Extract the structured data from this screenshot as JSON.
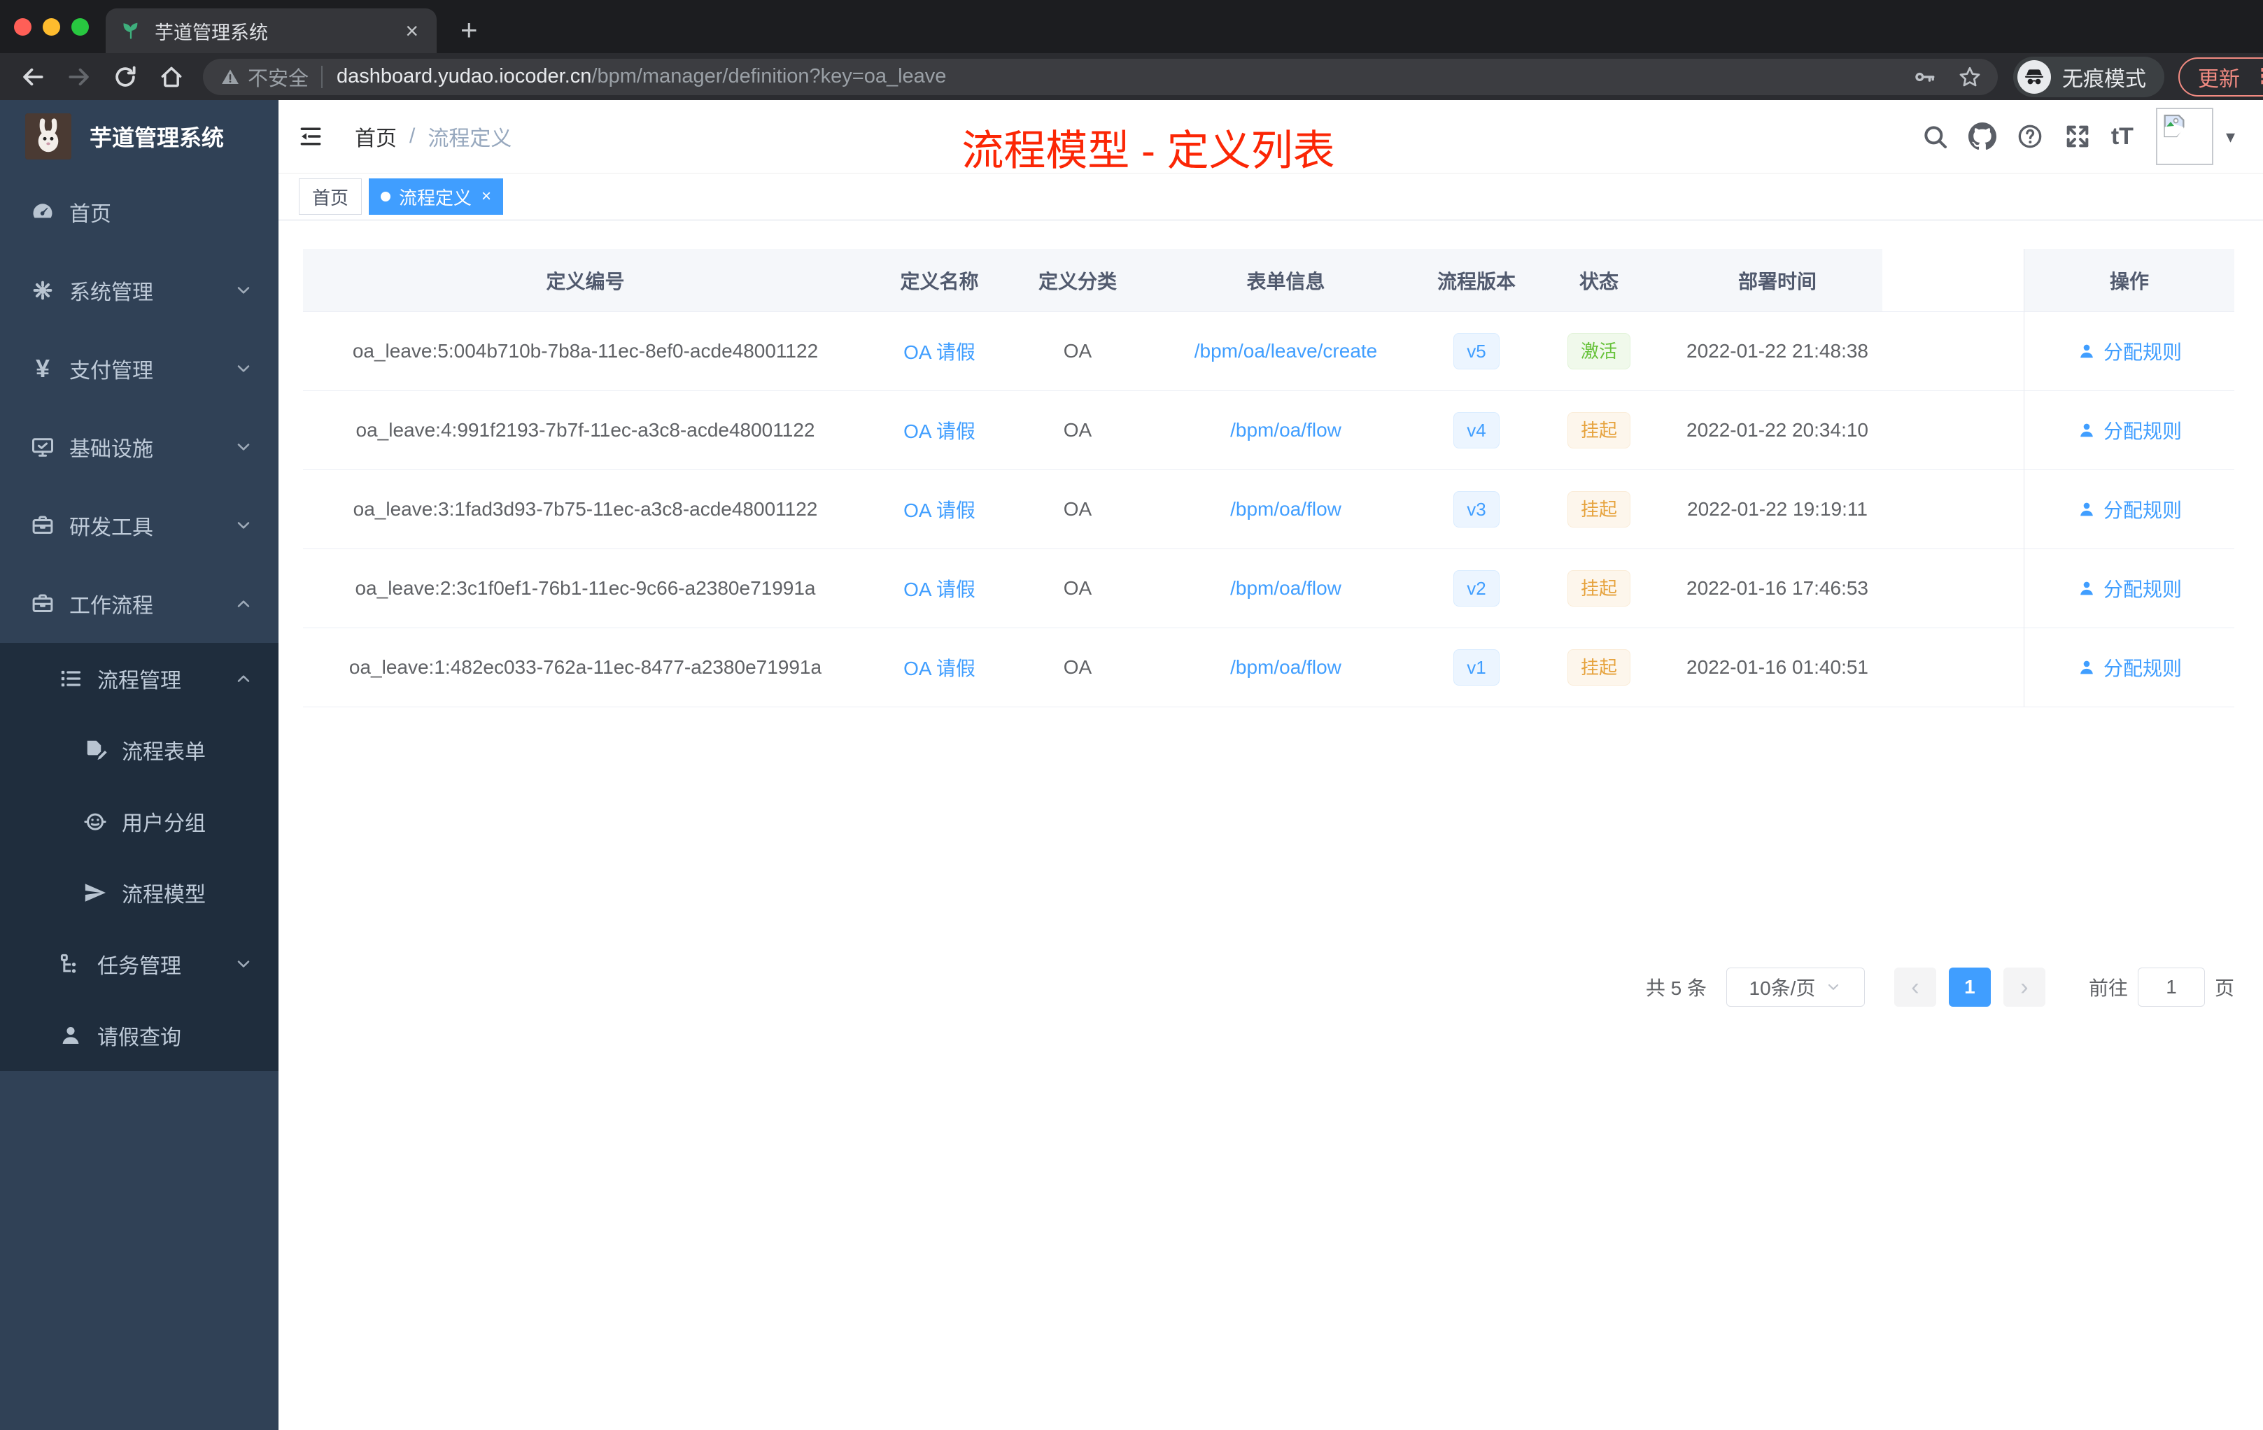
{
  "colors": {
    "accent": "#409eff",
    "sidebar_bg": "#304156",
    "submenu_bg": "#1f2d3d",
    "success": "#67c23a",
    "warning": "#e6a23c",
    "annotation_red": "#fb2605"
  },
  "icons": {
    "close": "×",
    "plus": "+",
    "more_dots": "⋮",
    "caret_down": "▾",
    "prev": "‹",
    "next": "›",
    "yen": "¥",
    "font_size": "tT",
    "breadcrumb_sep": "/"
  },
  "browser": {
    "tab_title": "芋道管理系统",
    "security_label": "不安全",
    "url_host": "dashboard.yudao.iocoder.cn",
    "url_path": "/bpm/manager/definition?key=oa_leave",
    "incognito_label": "无痕模式",
    "update_label": "更新"
  },
  "sidebar": {
    "logo_title": "芋道管理系统",
    "items": [
      {
        "label": "首页"
      },
      {
        "label": "系统管理"
      },
      {
        "label": "支付管理"
      },
      {
        "label": "基础设施"
      },
      {
        "label": "研发工具"
      },
      {
        "label": "工作流程"
      },
      {
        "label": "流程管理"
      },
      {
        "label": "流程表单"
      },
      {
        "label": "用户分组"
      },
      {
        "label": "流程模型"
      },
      {
        "label": "任务管理"
      },
      {
        "label": "请假查询"
      }
    ]
  },
  "header": {
    "breadcrumb": {
      "home": "首页",
      "current": "流程定义"
    },
    "annotation": {
      "text": "流程模型 - 定义列表",
      "color": "#fb2605"
    }
  },
  "tags": [
    {
      "label": "首页"
    },
    {
      "label": "流程定义"
    }
  ],
  "table": {
    "columns": [
      "定义编号",
      "定义名称",
      "定义分类",
      "表单信息",
      "流程版本",
      "状态",
      "部署时间",
      "操作"
    ],
    "rows": [
      {
        "id": "oa_leave:5:004b710b-7b8a-11ec-8ef0-acde48001122",
        "name": "OA 请假",
        "category": "OA",
        "form": "/bpm/oa/leave/create",
        "version": "v5",
        "status": {
          "label": "激活",
          "type": "success"
        },
        "time": "2022-01-22 21:48:38",
        "action": "分配规则"
      },
      {
        "id": "oa_leave:4:991f2193-7b7f-11ec-a3c8-acde48001122",
        "name": "OA 请假",
        "category": "OA",
        "form": "/bpm/oa/flow",
        "version": "v4",
        "status": {
          "label": "挂起",
          "type": "warning"
        },
        "time": "2022-01-22 20:34:10",
        "action": "分配规则"
      },
      {
        "id": "oa_leave:3:1fad3d93-7b75-11ec-a3c8-acde48001122",
        "name": "OA 请假",
        "category": "OA",
        "form": "/bpm/oa/flow",
        "version": "v3",
        "status": {
          "label": "挂起",
          "type": "warning"
        },
        "time": "2022-01-22 19:19:11",
        "action": "分配规则"
      },
      {
        "id": "oa_leave:2:3c1f0ef1-76b1-11ec-9c66-a2380e71991a",
        "name": "OA 请假",
        "category": "OA",
        "form": "/bpm/oa/flow",
        "version": "v2",
        "status": {
          "label": "挂起",
          "type": "warning"
        },
        "time": "2022-01-16 17:46:53",
        "action": "分配规则"
      },
      {
        "id": "oa_leave:1:482ec033-762a-11ec-8477-a2380e71991a",
        "name": "OA 请假",
        "category": "OA",
        "form": "/bpm/oa/flow",
        "version": "v1",
        "status": {
          "label": "挂起",
          "type": "warning"
        },
        "time": "2022-01-16 01:40:51",
        "action": "分配规则"
      }
    ]
  },
  "pagination": {
    "total": "共 5 条",
    "page_size": "10条/页",
    "current": "1",
    "goto_label": "前往",
    "goto_value": "1",
    "page_unit": "页"
  }
}
